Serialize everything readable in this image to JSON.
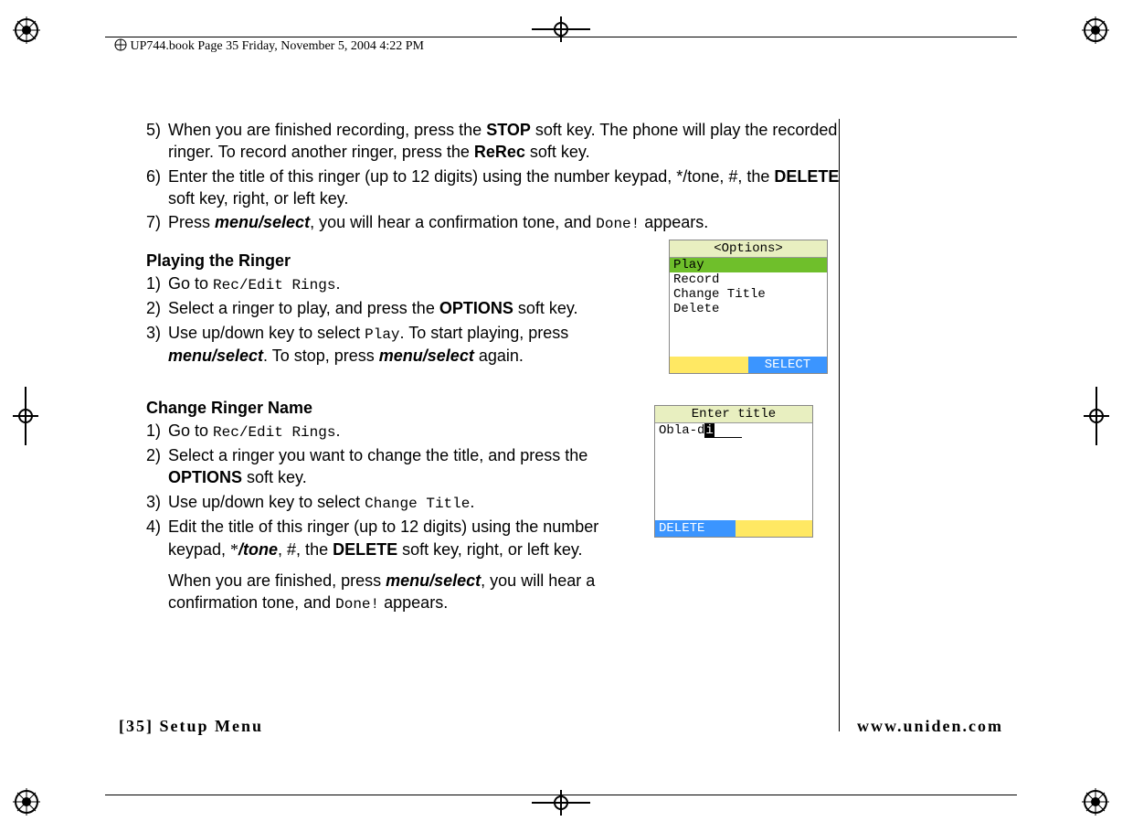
{
  "meta": {
    "header": "UP744.book  Page 35  Friday, November 5, 2004  4:22 PM"
  },
  "step5": {
    "idx": "5)",
    "t1": "When you are finished recording, press the ",
    "stop": "STOP",
    "t2": " soft key. The phone will play the recorded ringer. To record another ringer, press the ",
    "rerec": "ReRec",
    "t3": " soft key."
  },
  "step6": {
    "idx": "6)",
    "t1": "Enter the title of this ringer (up to 12 digits) using the number keypad, */tone, #, the ",
    "del": "DELETE",
    "t2": " soft key, right, or left key."
  },
  "step7": {
    "idx": "7)",
    "t1": "Press ",
    "cmd": "menu/select",
    "t2": ", you will hear a confirmation tone, and ",
    "done": "Done!",
    "t3": " appears."
  },
  "play": {
    "title": "Playing the Ringer",
    "s1": {
      "idx": "1)",
      "t1": "Go to ",
      "lcd": "Rec/Edit Rings",
      "t2": "."
    },
    "s2": {
      "idx": "2)",
      "t1": "Select a ringer to play, and press the ",
      "opt": "OPTIONS",
      "t2": " soft key."
    },
    "s3": {
      "idx": "3)",
      "t1": "Use up/down key to select ",
      "lcd": "Play",
      "t2": ". To start playing, press ",
      "cmd1": "menu/select",
      "t3": ". To stop, press ",
      "cmd2": "menu/select",
      "t4": " again."
    }
  },
  "rename": {
    "title": "Change Ringer Name",
    "s1": {
      "idx": "1)",
      "t1": "Go to ",
      "lcd": "Rec/Edit Rings",
      "t2": "."
    },
    "s2": {
      "idx": "2)",
      "t1": "Select a ringer you want to change the title, and press the ",
      "opt": "OPTIONS",
      "t2": " soft key."
    },
    "s3": {
      "idx": "3)",
      "t1": "Use up/down key to select ",
      "lcd": "Change Title",
      "t2": "."
    },
    "s4": {
      "idx": "4)",
      "t1": "Edit the title of this ringer (up to 12 digits) using the number keypad, ",
      "star": "*",
      "tone": "/tone",
      "t2": ", #, the ",
      "del": "DELETE",
      "t3": " soft key, right, or left key."
    },
    "finish": {
      "t1": "When you are finished, press ",
      "cmd": "menu/select",
      "t2": ", you will hear a confirmation tone, and ",
      "done": "Done!",
      "t3": " appears."
    }
  },
  "lcd_options": {
    "title": "<Options>",
    "items": [
      "Play",
      "Record",
      "Change Title",
      "Delete"
    ],
    "softkey_right": "SELECT"
  },
  "lcd_enter": {
    "title": "Enter title",
    "value": "Obla-d",
    "cursor": "i",
    "softkey_left": "DELETE"
  },
  "footer": {
    "left": "[35] Setup Menu",
    "right": "www.uniden.com"
  }
}
